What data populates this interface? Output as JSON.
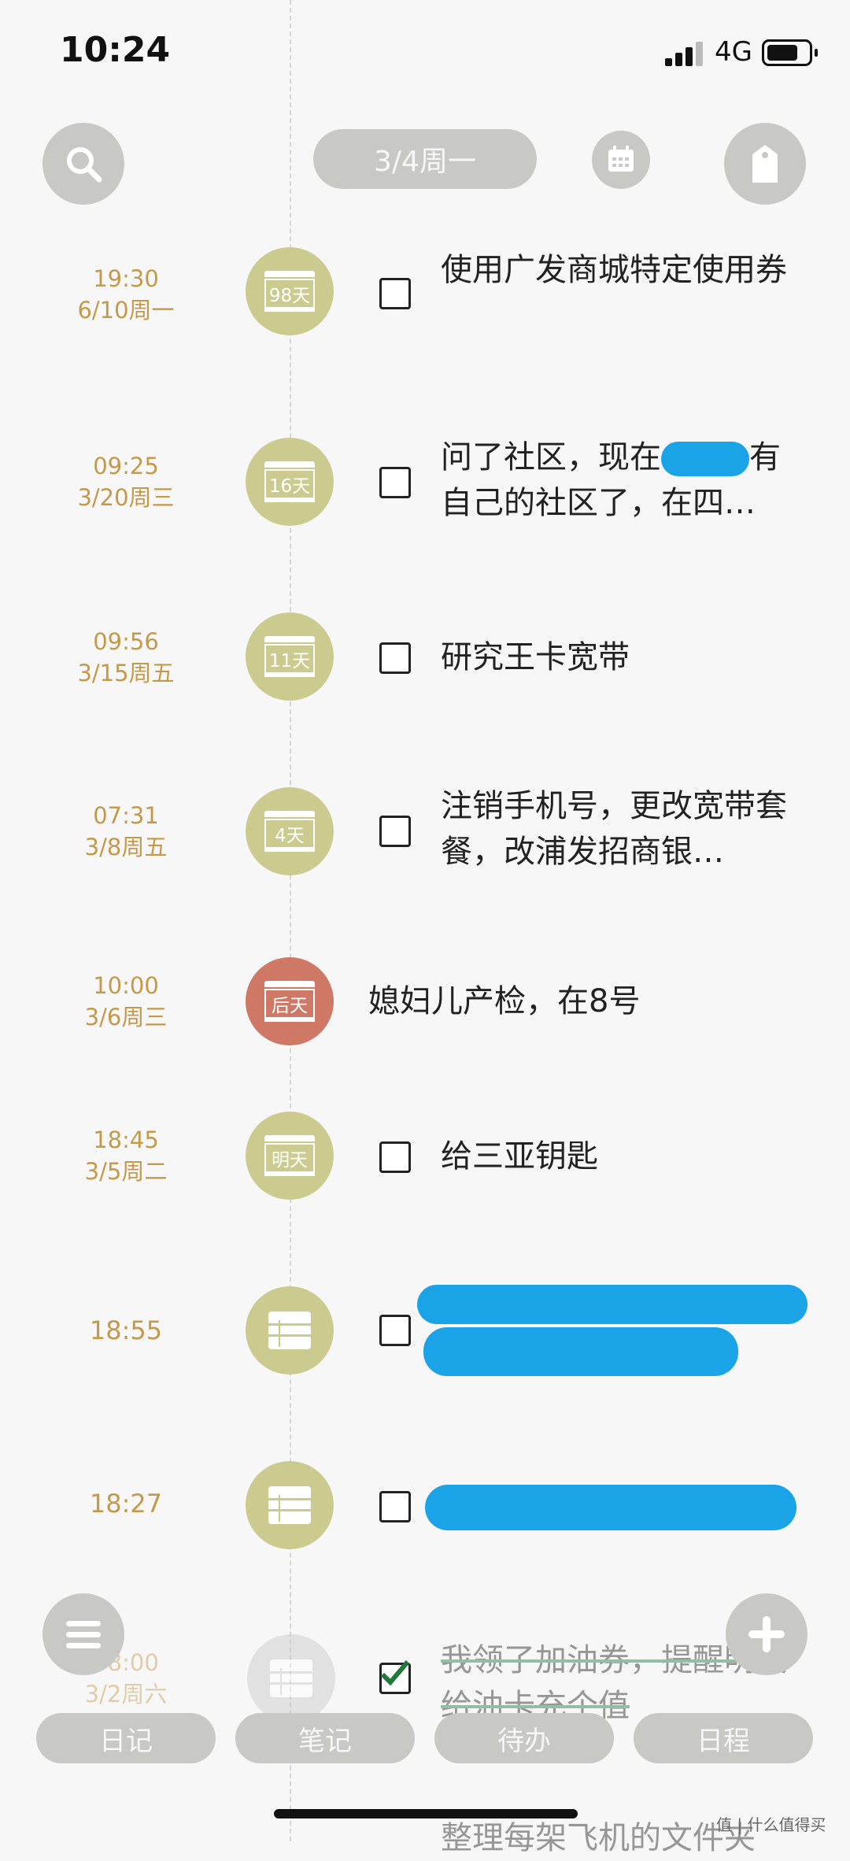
{
  "status_bar": {
    "time": "10:24",
    "network": "4G"
  },
  "header": {
    "date_label": "3/4周一"
  },
  "rows": [
    {
      "time": "19:30",
      "date": "6/10周一",
      "badge": "98天",
      "text": "使用广发商城特定使用券"
    },
    {
      "time": "09:25",
      "date": "3/20周三",
      "badge": "16天",
      "text_line1": "问了社区，现在",
      "text_line1b": "有",
      "text_line2": "自己的社区了，在四…"
    },
    {
      "time": "09:56",
      "date": "3/15周五",
      "badge": "11天",
      "text": "研究王卡宽带"
    },
    {
      "time": "07:31",
      "date": "3/8周五",
      "badge": "4天",
      "text": "注销手机号，更改宽带套餐，改浦发招商银…"
    },
    {
      "time": "10:00",
      "date": "3/6周三",
      "badge": "后天",
      "text": "媳妇儿产检，在8号"
    },
    {
      "time": "18:45",
      "date": "3/5周二",
      "badge": "明天",
      "text": "给三亚钥匙"
    },
    {
      "time": "18:55"
    },
    {
      "time": "18:27"
    },
    {
      "time": "08:00",
      "date": "3/2周六",
      "text": "我领了加油券，提醒明天给油卡充个值"
    },
    {
      "text": "整理每架飞机的文件夹"
    }
  ],
  "tabs": [
    "日记",
    "笔记",
    "待办",
    "日程"
  ],
  "watermark": "值 | 什么值得买",
  "colors": {
    "accent_time": "#c49a4a",
    "badge_olive": "#cccb8f",
    "badge_red": "#d07866",
    "button_gray": "#c8c8c4"
  }
}
